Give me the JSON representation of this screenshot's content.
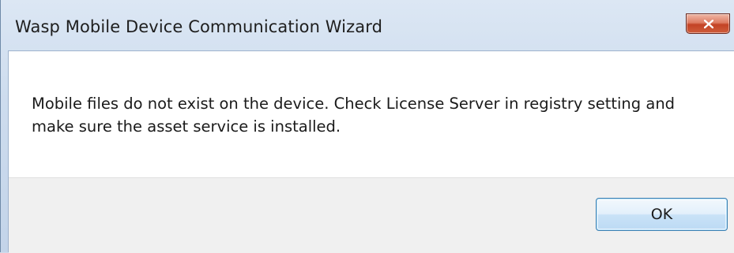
{
  "window": {
    "title": "Wasp Mobile Device Communication Wizard"
  },
  "dialog": {
    "message": "Mobile files do not exist on the device. Check License Server in registry setting and make sure the asset service is installed.",
    "ok_label": "OK"
  },
  "icons": {
    "close": "close-icon"
  },
  "colors": {
    "close_button": "#c94a2c",
    "ok_border": "#3c7fb1",
    "titlebar": "#cddcee"
  }
}
